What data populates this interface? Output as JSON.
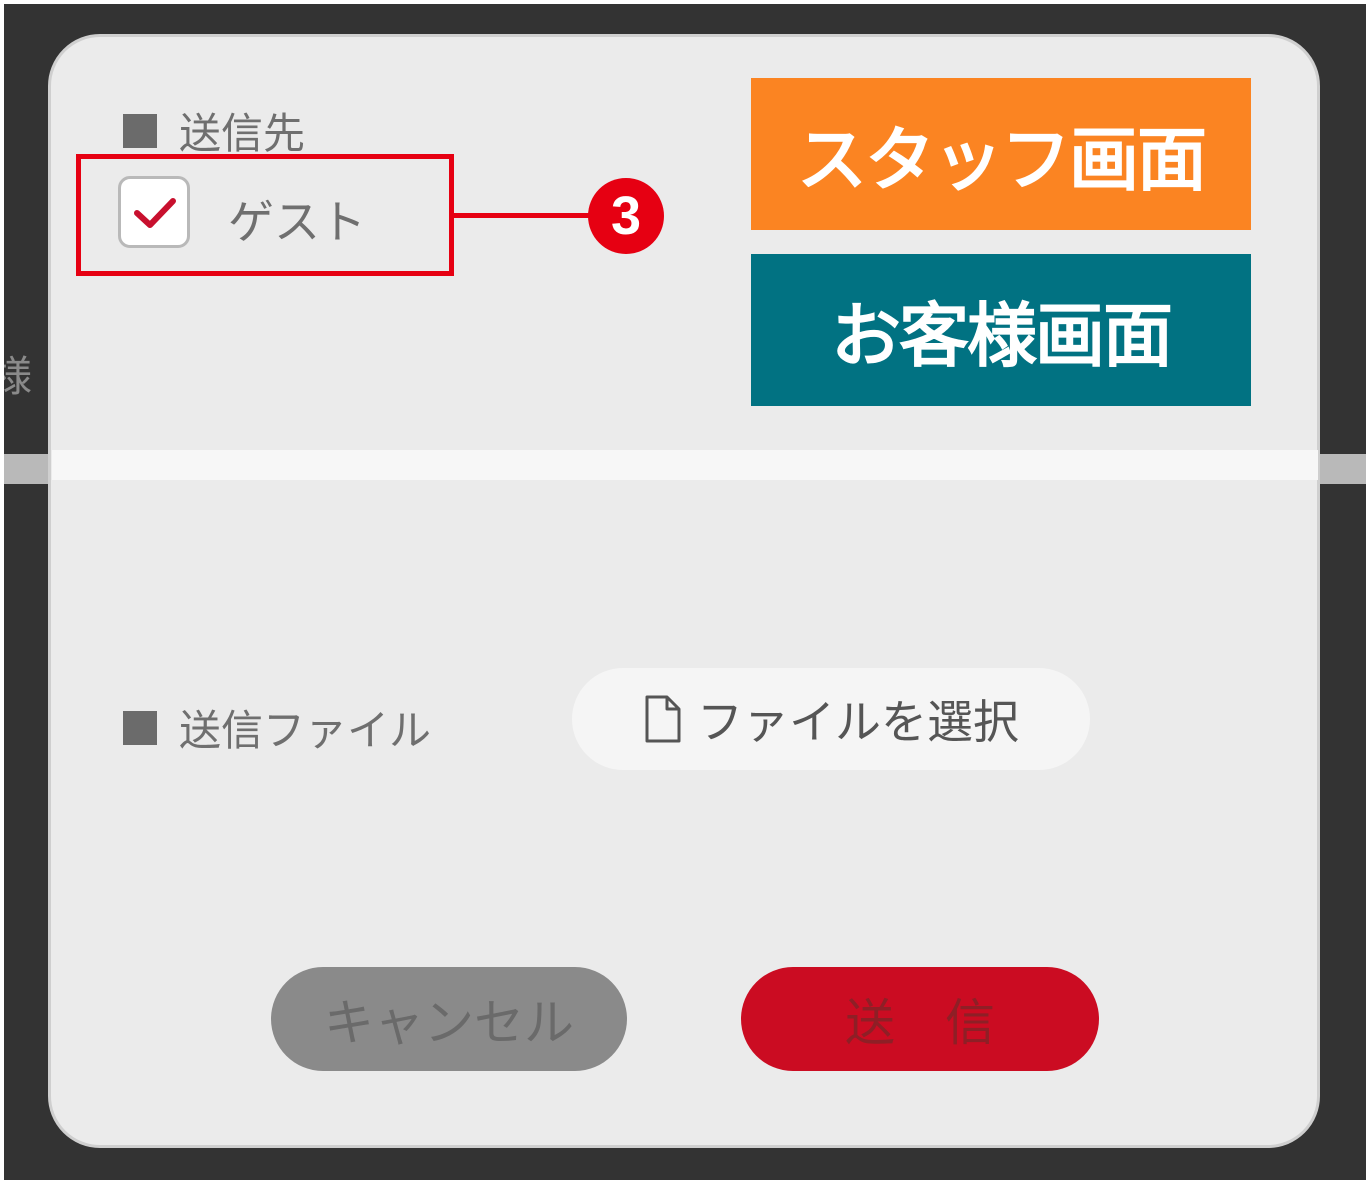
{
  "background": {
    "partial_char": "様"
  },
  "dialog": {
    "destination_label": "送信先",
    "guest_checkbox": {
      "label": "ゲスト",
      "checked": true
    },
    "file_label": "送信ファイル",
    "file_button_label": "ファイルを選択",
    "cancel_label": "キャンセル",
    "send_label": "送　信"
  },
  "annotations": {
    "callout_number": "3",
    "staff_screen_tag": "スタッフ画面",
    "guest_screen_tag": "お客様画面"
  },
  "colors": {
    "callout": "#e60012",
    "staff_tag": "#fb8422",
    "guest_tag": "#017282",
    "send_button": "#cb0c22",
    "cancel_button": "#8a8a8a"
  },
  "icons": [
    "square-bullet-icon",
    "check-icon",
    "file-icon"
  ]
}
